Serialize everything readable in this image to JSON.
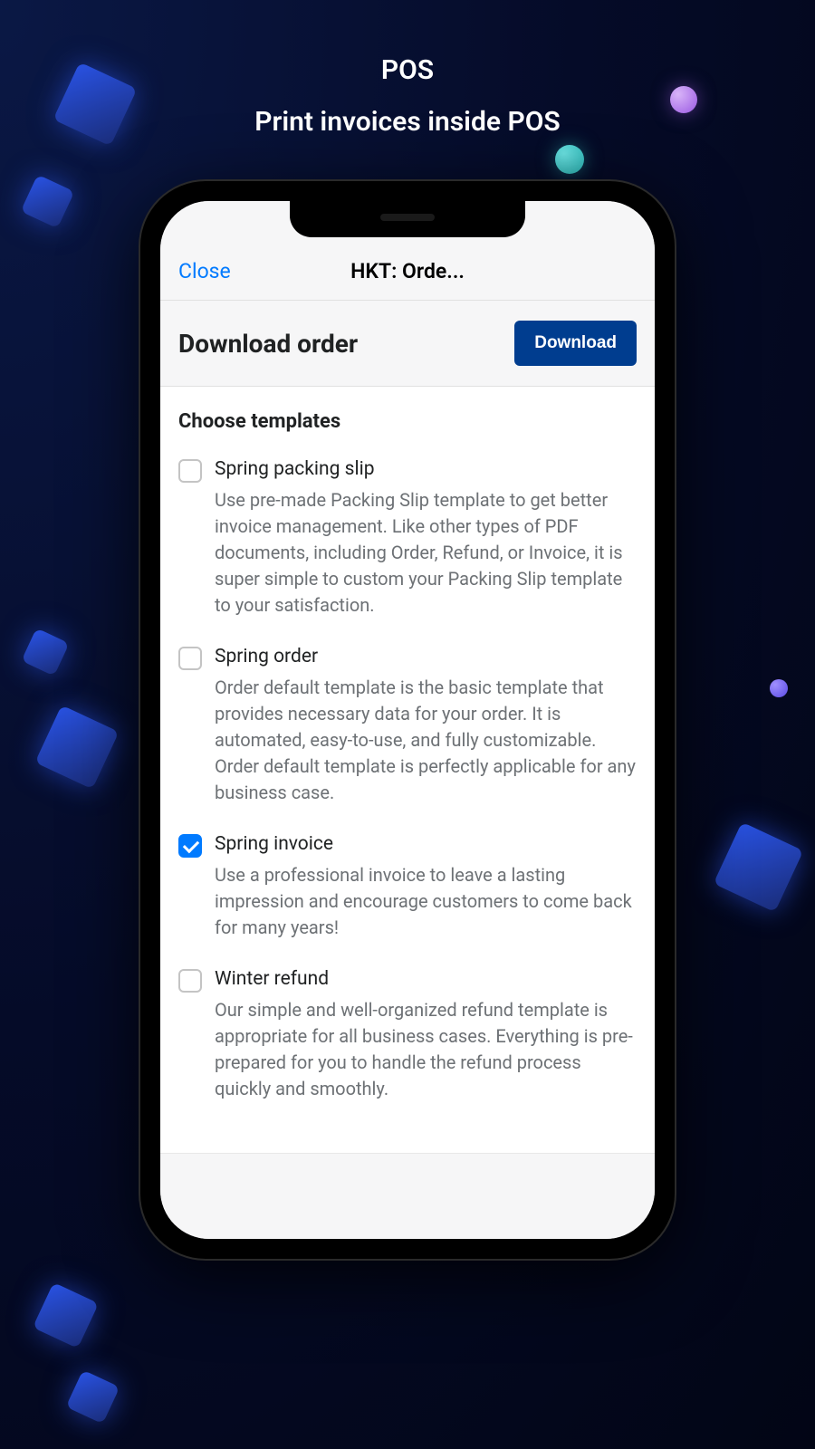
{
  "header": {
    "title": "POS",
    "subtitle": "Print invoices inside POS"
  },
  "nav": {
    "close_label": "Close",
    "title": "HKT: Orde..."
  },
  "download": {
    "heading": "Download order",
    "button_label": "Download"
  },
  "templates": {
    "section_title": "Choose templates",
    "items": [
      {
        "name": "Spring packing slip",
        "description": "Use pre-made Packing Slip template to get better invoice management. Like other types of PDF documents, including Order, Refund, or Invoice, it is super simple to custom your Packing Slip template to your satisfaction.",
        "checked": false
      },
      {
        "name": "Spring order",
        "description": "Order default template is the basic template that provides necessary data for your order. It is automated, easy-to-use, and fully customizable. Order default template is perfectly applicable for any business case.",
        "checked": false
      },
      {
        "name": "Spring invoice",
        "description": "Use a professional invoice to leave a lasting impression and encourage customers to come back for many years!",
        "checked": true
      },
      {
        "name": "Winter refund",
        "description": "Our simple and well-organized refund template is appropriate for all business cases. Everything is pre-prepared for you to handle the refund process quickly and smoothly.",
        "checked": false
      }
    ]
  }
}
